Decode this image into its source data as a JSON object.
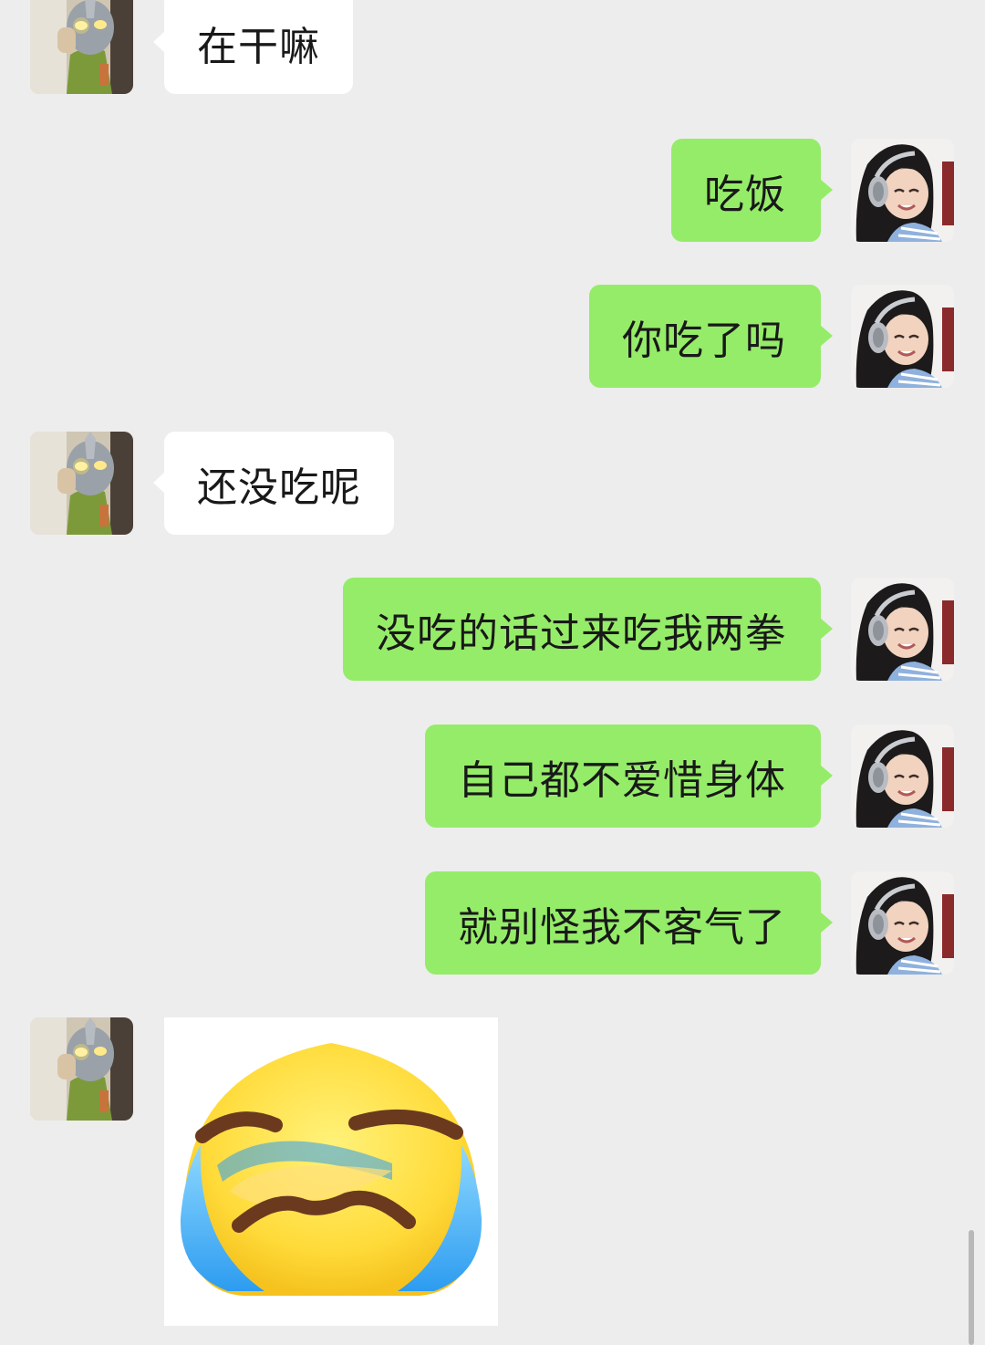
{
  "messages": [
    {
      "from": "other",
      "text": "在干嘛"
    },
    {
      "from": "me",
      "text": "吃饭"
    },
    {
      "from": "me",
      "text": "你吃了吗"
    },
    {
      "from": "other",
      "text": "还没吃呢"
    },
    {
      "from": "me",
      "text": "没吃的话过来吃我两拳"
    },
    {
      "from": "me",
      "text": "自己都不爱惜身体"
    },
    {
      "from": "me",
      "text": "就别怪我不客气了"
    },
    {
      "from": "other",
      "type": "sticker",
      "icon": "crying-face-sticker"
    }
  ],
  "colors": {
    "background": "#ededed",
    "incoming_bubble": "#ffffff",
    "outgoing_bubble": "#95ec69",
    "text": "#191919"
  }
}
